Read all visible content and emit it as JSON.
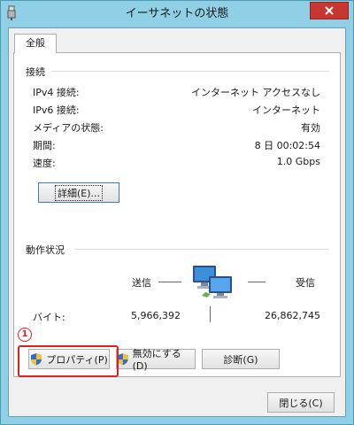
{
  "window": {
    "title": "イーサネットの状態",
    "close_label": "閉じる(C)"
  },
  "tabs": [
    {
      "label": "全般"
    }
  ],
  "connection": {
    "heading": "接続",
    "rows": [
      {
        "label": "IPv4 接続:",
        "value": "インターネット アクセスなし"
      },
      {
        "label": "IPv6 接続:",
        "value": "インターネット"
      },
      {
        "label": "メディアの状態:",
        "value": "有効"
      },
      {
        "label": "期間:",
        "value": "8 日 00:02:54"
      },
      {
        "label": "速度:",
        "value": "1.0 Gbps"
      }
    ],
    "details_button": "詳細(E)..."
  },
  "activity": {
    "heading": "動作状況",
    "sent_label": "送信",
    "received_label": "受信",
    "bytes_label": "バイト:",
    "sent_bytes": "5,966,392",
    "received_bytes": "26,862,745"
  },
  "buttons": {
    "properties": "プロパティ(P)",
    "disable": "無効にする(D)",
    "diagnose": "診断(G)"
  },
  "annotation": {
    "step_marker": "1"
  },
  "icons": {
    "app": "ethernet-icon",
    "close": "close-icon",
    "network": "network-computers-icon",
    "shield": "uac-shield-icon"
  },
  "colors": {
    "titlebar": "#8fd0e6",
    "close_button": "#c7372f",
    "highlight": "#e02020"
  }
}
